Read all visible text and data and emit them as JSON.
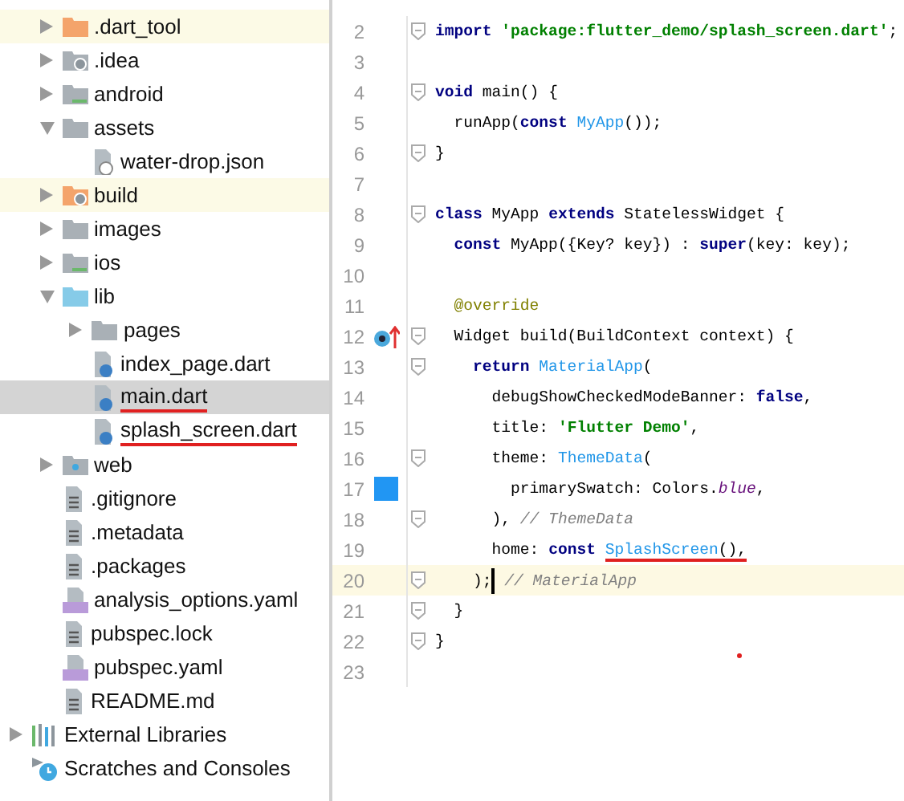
{
  "project_tree": [
    {
      "name": ".dart_tool",
      "kind": "excluded-folder",
      "expanded": false,
      "highlighted": true,
      "selected": false
    },
    {
      "name": ".idea",
      "kind": "settings-folder",
      "expanded": false,
      "highlighted": false,
      "selected": false
    },
    {
      "name": "android",
      "kind": "platform-folder",
      "expanded": false,
      "highlighted": false,
      "selected": false
    },
    {
      "name": "assets",
      "kind": "folder",
      "expanded": true,
      "highlighted": false,
      "selected": false,
      "children": [
        {
          "name": "water-drop.json",
          "kind": "json-file",
          "highlighted": false,
          "selected": false
        }
      ]
    },
    {
      "name": "build",
      "kind": "excluded-settings-folder",
      "expanded": false,
      "highlighted": true,
      "selected": false
    },
    {
      "name": "images",
      "kind": "folder",
      "expanded": false,
      "highlighted": false,
      "selected": false
    },
    {
      "name": "ios",
      "kind": "platform-folder",
      "expanded": false,
      "highlighted": false,
      "selected": false
    },
    {
      "name": "lib",
      "kind": "source-folder",
      "expanded": true,
      "highlighted": false,
      "selected": false,
      "children": [
        {
          "name": "pages",
          "kind": "folder",
          "expanded": false,
          "highlighted": false,
          "selected": false
        },
        {
          "name": "index_page.dart",
          "kind": "dart-file",
          "highlighted": false,
          "selected": false
        },
        {
          "name": "main.dart",
          "kind": "dart-file",
          "highlighted": false,
          "selected": true,
          "underlined": true
        },
        {
          "name": "splash_screen.dart",
          "kind": "dart-file",
          "highlighted": false,
          "selected": false,
          "underlined": true
        }
      ]
    },
    {
      "name": "web",
      "kind": "web-folder",
      "expanded": false,
      "highlighted": false,
      "selected": false
    },
    {
      "name": ".gitignore",
      "kind": "text-file",
      "highlighted": false,
      "selected": false
    },
    {
      "name": ".metadata",
      "kind": "text-file",
      "highlighted": false,
      "selected": false
    },
    {
      "name": ".packages",
      "kind": "text-file",
      "highlighted": false,
      "selected": false
    },
    {
      "name": "analysis_options.yaml",
      "kind": "yaml-file",
      "highlighted": false,
      "selected": false
    },
    {
      "name": "pubspec.lock",
      "kind": "text-file",
      "highlighted": false,
      "selected": false
    },
    {
      "name": "pubspec.yaml",
      "kind": "yaml-file",
      "highlighted": false,
      "selected": false
    },
    {
      "name": "README.md",
      "kind": "text-file",
      "highlighted": false,
      "selected": false
    }
  ],
  "root_items": [
    {
      "name": "External Libraries",
      "kind": "libraries",
      "expanded": false
    },
    {
      "name": "Scratches and Consoles",
      "kind": "scratches"
    }
  ],
  "code_lines": [
    {
      "number": "2",
      "fold": true,
      "current": false,
      "tokens": [
        {
          "kind": "keyword",
          "text": "import "
        },
        {
          "kind": "string",
          "text": "'package:flutter_demo/splash_screen.dart'"
        },
        {
          "kind": "plain",
          "text": ";"
        }
      ]
    },
    {
      "number": "3",
      "fold": false,
      "current": false
    },
    {
      "number": "4",
      "fold": true,
      "current": false,
      "tokens": [
        {
          "kind": "keyword",
          "text": "void"
        },
        {
          "kind": "plain",
          "text": " main() {"
        }
      ]
    },
    {
      "number": "5",
      "fold": false,
      "current": false,
      "tokens": [
        {
          "kind": "plain",
          "text": "  runApp("
        },
        {
          "kind": "keyword",
          "text": "const "
        },
        {
          "kind": "class",
          "text": "MyApp"
        },
        {
          "kind": "plain",
          "text": "());"
        }
      ]
    },
    {
      "number": "6",
      "fold": true,
      "current": false,
      "tokens": [
        {
          "kind": "plain",
          "text": "}"
        }
      ]
    },
    {
      "number": "7",
      "fold": false,
      "current": false
    },
    {
      "number": "8",
      "fold": true,
      "current": false,
      "tokens": [
        {
          "kind": "keyword",
          "text": "class"
        },
        {
          "kind": "plain",
          "text": " MyApp "
        },
        {
          "kind": "keyword",
          "text": "extends"
        },
        {
          "kind": "plain",
          "text": " StatelessWidget {"
        }
      ]
    },
    {
      "number": "9",
      "fold": false,
      "current": false,
      "tokens": [
        {
          "kind": "keyword",
          "text": "  const"
        },
        {
          "kind": "plain",
          "text": " MyApp({Key? key}) : "
        },
        {
          "kind": "keyword",
          "text": "super"
        },
        {
          "kind": "plain",
          "text": "(key: key);"
        }
      ]
    },
    {
      "number": "10",
      "fold": false,
      "current": false
    },
    {
      "number": "11",
      "fold": false,
      "current": false,
      "tokens": [
        {
          "kind": "annotation",
          "text": "  @override"
        }
      ]
    },
    {
      "number": "12",
      "fold": true,
      "current": false,
      "marker": {
        "kind": "override"
      },
      "tokens": [
        {
          "kind": "plain",
          "text": "  Widget build(BuildContext context) {"
        }
      ]
    },
    {
      "number": "13",
      "fold": true,
      "current": false,
      "tokens": [
        {
          "kind": "keyword",
          "text": "    return "
        },
        {
          "kind": "class",
          "text": "MaterialApp"
        },
        {
          "kind": "plain",
          "text": "("
        }
      ]
    },
    {
      "number": "14",
      "fold": false,
      "current": false,
      "tokens": [
        {
          "kind": "plain",
          "text": "      debugShowCheckedModeBanner: "
        },
        {
          "kind": "keyword",
          "text": "false"
        },
        {
          "kind": "plain",
          "text": ","
        }
      ]
    },
    {
      "number": "15",
      "fold": false,
      "current": false,
      "tokens": [
        {
          "kind": "plain",
          "text": "      title: "
        },
        {
          "kind": "string",
          "text": "'Flutter Demo'"
        },
        {
          "kind": "plain",
          "text": ","
        }
      ]
    },
    {
      "number": "16",
      "fold": true,
      "current": false,
      "tokens": [
        {
          "kind": "plain",
          "text": "      theme: "
        },
        {
          "kind": "class",
          "text": "ThemeData"
        },
        {
          "kind": "plain",
          "text": "("
        }
      ]
    },
    {
      "number": "17",
      "fold": false,
      "current": false,
      "marker": {
        "kind": "color-swatch"
      },
      "tokens": [
        {
          "kind": "plain",
          "text": "        primarySwatch: Colors."
        },
        {
          "kind": "constant",
          "text": "blue"
        },
        {
          "kind": "plain",
          "text": ","
        }
      ]
    },
    {
      "number": "18",
      "fold": true,
      "current": false,
      "tokens": [
        {
          "kind": "plain",
          "text": "      ), "
        },
        {
          "kind": "comment",
          "text": "// ThemeData"
        }
      ]
    },
    {
      "number": "19",
      "fold": false,
      "current": false,
      "tokens": [
        {
          "kind": "plain",
          "text": "      home: "
        },
        {
          "kind": "keyword",
          "text": "const "
        },
        {
          "kind": "class",
          "text": "SplashScreen",
          "underlined": true
        },
        {
          "kind": "plain",
          "text": "(),",
          "underlined": true
        }
      ]
    },
    {
      "number": "20",
      "fold": true,
      "current": true,
      "tokens": [
        {
          "kind": "plain",
          "text": "    );"
        },
        {
          "kind": "comment",
          "text": " // MaterialApp",
          "caret_before": true
        }
      ]
    },
    {
      "number": "21",
      "fold": true,
      "current": false,
      "tokens": [
        {
          "kind": "plain",
          "text": "  }"
        }
      ]
    },
    {
      "number": "22",
      "fold": true,
      "current": false,
      "tokens": [
        {
          "kind": "plain",
          "text": "}"
        }
      ]
    },
    {
      "number": "23",
      "fold": false,
      "current": false
    }
  ]
}
